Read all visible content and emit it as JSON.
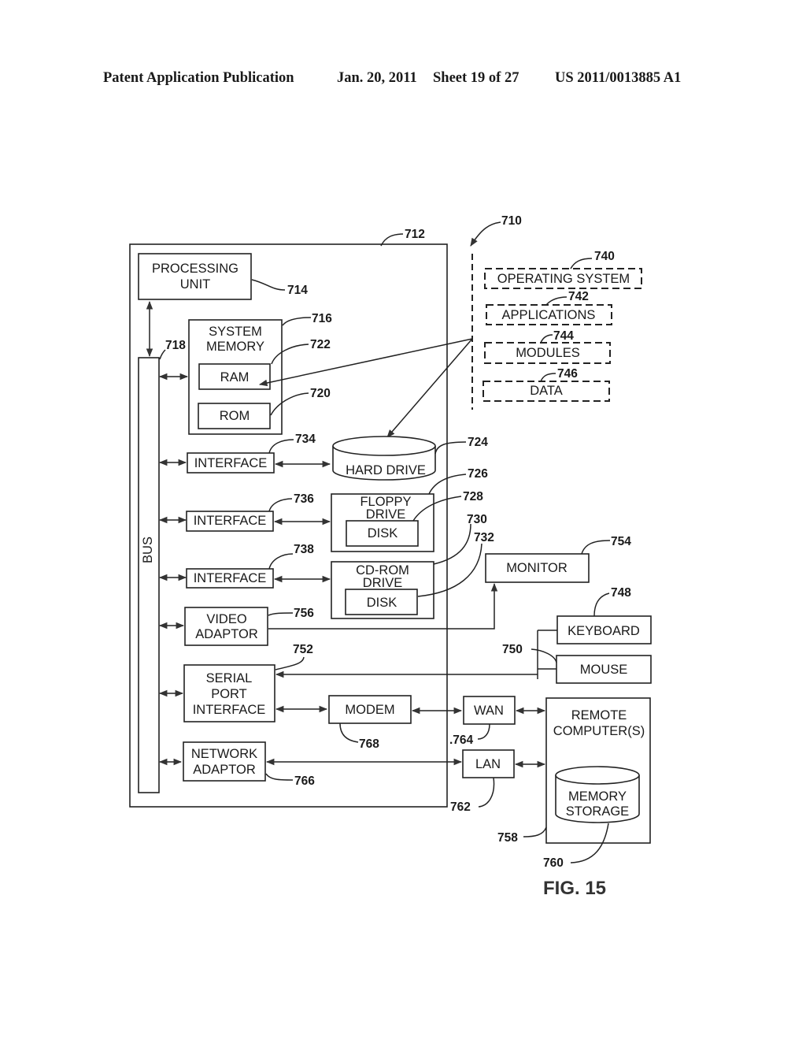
{
  "header": {
    "publication": "Patent Application Publication",
    "date": "Jan. 20, 2011",
    "sheet": "Sheet 19 of 27",
    "number": "US 2011/0013885 A1"
  },
  "figure_label": "FIG. 15",
  "computer": {
    "ref": "712",
    "processing_unit": {
      "line1": "PROCESSING",
      "line2": "UNIT",
      "ref": "714"
    },
    "bus": {
      "label": "BUS",
      "ref": "718"
    },
    "system_memory": {
      "line1": "SYSTEM",
      "line2": "MEMORY",
      "ref": "716",
      "ram": {
        "label": "RAM",
        "ref": "722"
      },
      "rom": {
        "label": "ROM",
        "ref": "720"
      }
    },
    "interfaces": [
      {
        "label": "INTERFACE",
        "ref": "734"
      },
      {
        "label": "INTERFACE",
        "ref": "736"
      },
      {
        "label": "INTERFACE",
        "ref": "738"
      }
    ],
    "hard_drive": {
      "label": "HARD DRIVE",
      "ref": "724"
    },
    "floppy_drive": {
      "line1": "FLOPPY",
      "line2": "DRIVE",
      "ref": "726",
      "disk": {
        "label": "DISK",
        "ref": "728"
      }
    },
    "cdrom_drive": {
      "line1": "CD-ROM",
      "line2": "DRIVE",
      "ref": "730",
      "disk": {
        "label": "DISK",
        "ref": "732"
      }
    },
    "video_adaptor": {
      "line1": "VIDEO",
      "line2": "ADAPTOR",
      "ref": "756"
    },
    "serial_port": {
      "line1": "SERIAL",
      "line2": "PORT",
      "line3": "INTERFACE",
      "ref": "752"
    },
    "modem": {
      "label": "MODEM",
      "ref": "768"
    },
    "network_adaptor": {
      "line1": "NETWORK",
      "line2": "ADAPTOR",
      "ref": "766"
    }
  },
  "software": {
    "ref": "710",
    "items": [
      {
        "label": "OPERATING SYSTEM",
        "ref": "740"
      },
      {
        "label": "APPLICATIONS",
        "ref": "742"
      },
      {
        "label": "MODULES",
        "ref": "744"
      },
      {
        "label": "DATA",
        "ref": "746"
      }
    ]
  },
  "peripherals": {
    "monitor": {
      "label": "MONITOR",
      "ref": "754"
    },
    "keyboard": {
      "label": "KEYBOARD",
      "ref": "748"
    },
    "mouse": {
      "label": "MOUSE",
      "ref": "750"
    },
    "wan": {
      "label": "WAN",
      "ref": ".764"
    },
    "lan": {
      "label": "LAN",
      "ref": "762"
    },
    "remote": {
      "line1": "REMOTE",
      "line2": "COMPUTER(S)",
      "ref": "758",
      "storage": {
        "line1": "MEMORY",
        "line2": "STORAGE",
        "ref": "760"
      }
    }
  }
}
